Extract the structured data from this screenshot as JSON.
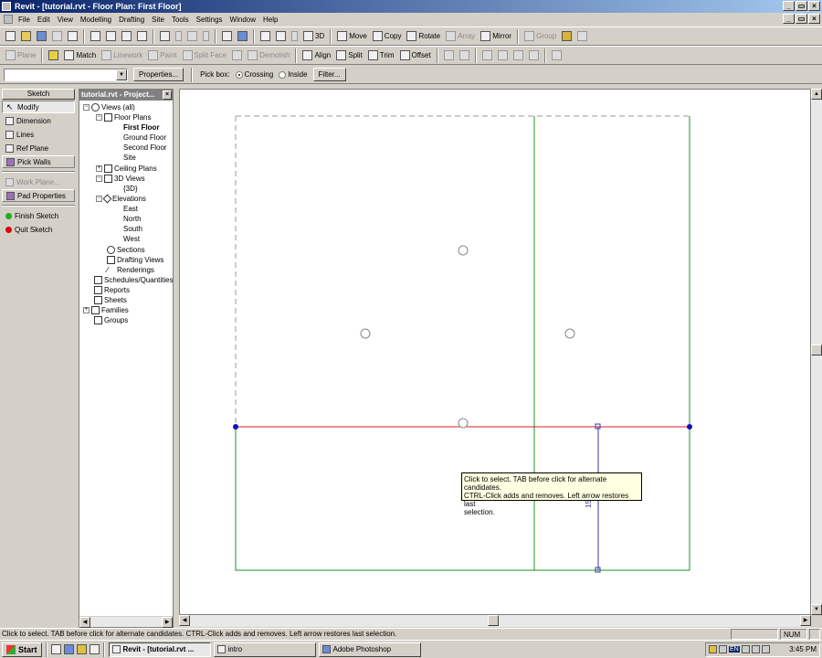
{
  "window": {
    "title": "Revit - [tutorial.rvt - Floor Plan: First Floor]",
    "buttons": [
      "_",
      "▭",
      "×"
    ],
    "inner_buttons": [
      "_",
      "▭",
      "×"
    ]
  },
  "menu": [
    "File",
    "Edit",
    "View",
    "Modelling",
    "Drafting",
    "Site",
    "Tools",
    "Settings",
    "Window",
    "Help"
  ],
  "toolbar1": {
    "three_d": "3D",
    "move": "Move",
    "copy": "Copy",
    "rotate": "Rotate",
    "array": "Array",
    "mirror": "Mirror",
    "group": "Group"
  },
  "toolbar2": {
    "plane": "Plane",
    "match": "Match",
    "linework": "Linework",
    "paint": "Paint",
    "split_face": "Split Face",
    "demolish": "Demolish",
    "align": "Align",
    "split": "Split",
    "trim": "Trim",
    "offset": "Offset"
  },
  "options": {
    "properties_label": "Properties...",
    "pick_box_label": "Pick box:",
    "crossing": "Crossing",
    "inside": "Inside",
    "filter_label": "Filter..."
  },
  "sketch": {
    "header": "Sketch",
    "items": [
      {
        "label": "Modify"
      },
      {
        "label": "Dimension"
      },
      {
        "label": "Lines"
      },
      {
        "label": "Ref Plane"
      },
      {
        "label": "Pick Walls"
      },
      {
        "label": "Work Plane..."
      },
      {
        "label": "Pad Properties"
      },
      {
        "label": "Finish Sketch"
      },
      {
        "label": "Quit Sketch"
      }
    ]
  },
  "browser": {
    "title": "tutorial.rvt - Project...",
    "tree": [
      {
        "label": "Views (all)"
      },
      {
        "label": "Floor Plans"
      },
      {
        "label": "First Floor"
      },
      {
        "label": "Ground Floor"
      },
      {
        "label": "Second Floor"
      },
      {
        "label": "Site"
      },
      {
        "label": "Ceiling Plans"
      },
      {
        "label": "3D Views"
      },
      {
        "label": "{3D}"
      },
      {
        "label": "Elevations"
      },
      {
        "label": "East"
      },
      {
        "label": "North"
      },
      {
        "label": "South"
      },
      {
        "label": "West"
      },
      {
        "label": "Sections"
      },
      {
        "label": "Drafting Views"
      },
      {
        "label": "Renderings"
      },
      {
        "label": "Schedules/Quantities"
      },
      {
        "label": "Reports"
      },
      {
        "label": "Sheets"
      },
      {
        "label": "Families"
      },
      {
        "label": "Groups"
      }
    ]
  },
  "canvas": {
    "tooltip": [
      "Click to select. TAB before click for alternate candidates.",
      "CTRL-Click adds and removes. Left arrow restores last",
      "selection."
    ],
    "dimension_text": "15",
    "colors": {
      "sketch_line": "#d62020",
      "wall_line": "#1f8f1f",
      "dimension": "#3a3aa0",
      "handle": "#1010c8"
    }
  },
  "status": {
    "message": "Click to select. TAB before click for alternate candidates. CTRL-Click adds and removes. Left arrow restores last selection.",
    "num": "NUM"
  },
  "taskbar": {
    "start": "Start",
    "tasks": [
      {
        "label": "Revit - [tutorial.rvt ..."
      },
      {
        "label": "intro"
      },
      {
        "label": "Adobe Photoshop"
      }
    ],
    "lang": "EN",
    "clock": "3:45 PM"
  }
}
